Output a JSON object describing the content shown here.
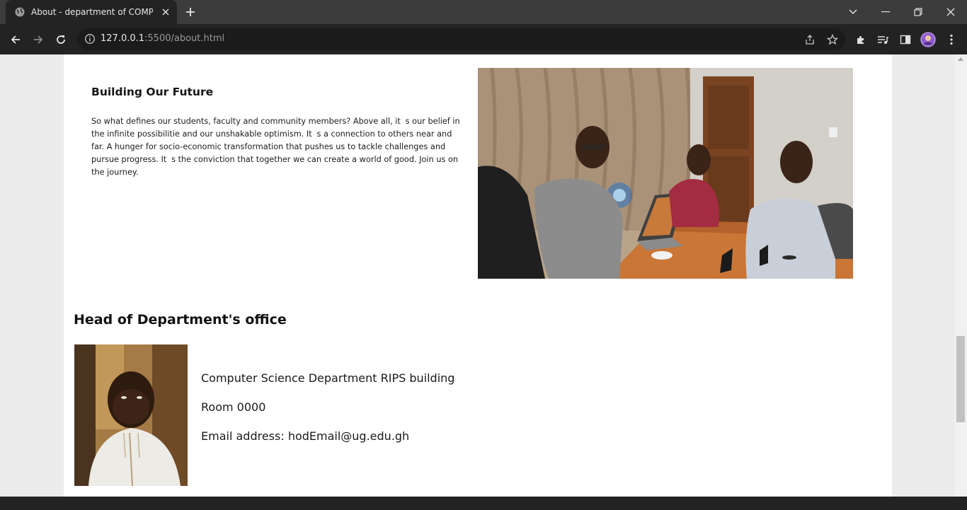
{
  "browser": {
    "tab_title": "About - department of COMPUTER SCIENCE",
    "url_host": "127.0.0.1",
    "url_path": ":5500/about.html",
    "icons": [
      "globe-icon",
      "close-icon",
      "plus-icon",
      "tab-search-icon",
      "minimize-icon",
      "restore-icon",
      "window-close-icon",
      "back-icon",
      "forward-icon",
      "reload-icon",
      "info-icon",
      "share-icon",
      "star-icon",
      "extensions-icon",
      "media-icon",
      "side-panel-icon",
      "profile-avatar",
      "menu-icon"
    ]
  },
  "page": {
    "future": {
      "heading": "Building Our Future",
      "body": "So what defines our students, faculty and community members? Above all, its our belief in the infinite possibilitie and our unshakable optimism. Its a connection to others near and far. A hunger for socio-economic transformation that pushes us to tackle challenges and pursue progress. Its the conviction that together we can create a world of good. Join us on the journey."
    },
    "hod": {
      "heading": "Head of Department's office",
      "building": "Computer Science Department RIPS building",
      "room": "Room 0000",
      "email": "Email address: hodEmail@ug.edu.gh"
    }
  },
  "colors": {
    "chrome_dark": "#232323",
    "tabstrip": "#3c3c3c",
    "page_bg": "#ececec",
    "content_bg": "#ffffff"
  }
}
